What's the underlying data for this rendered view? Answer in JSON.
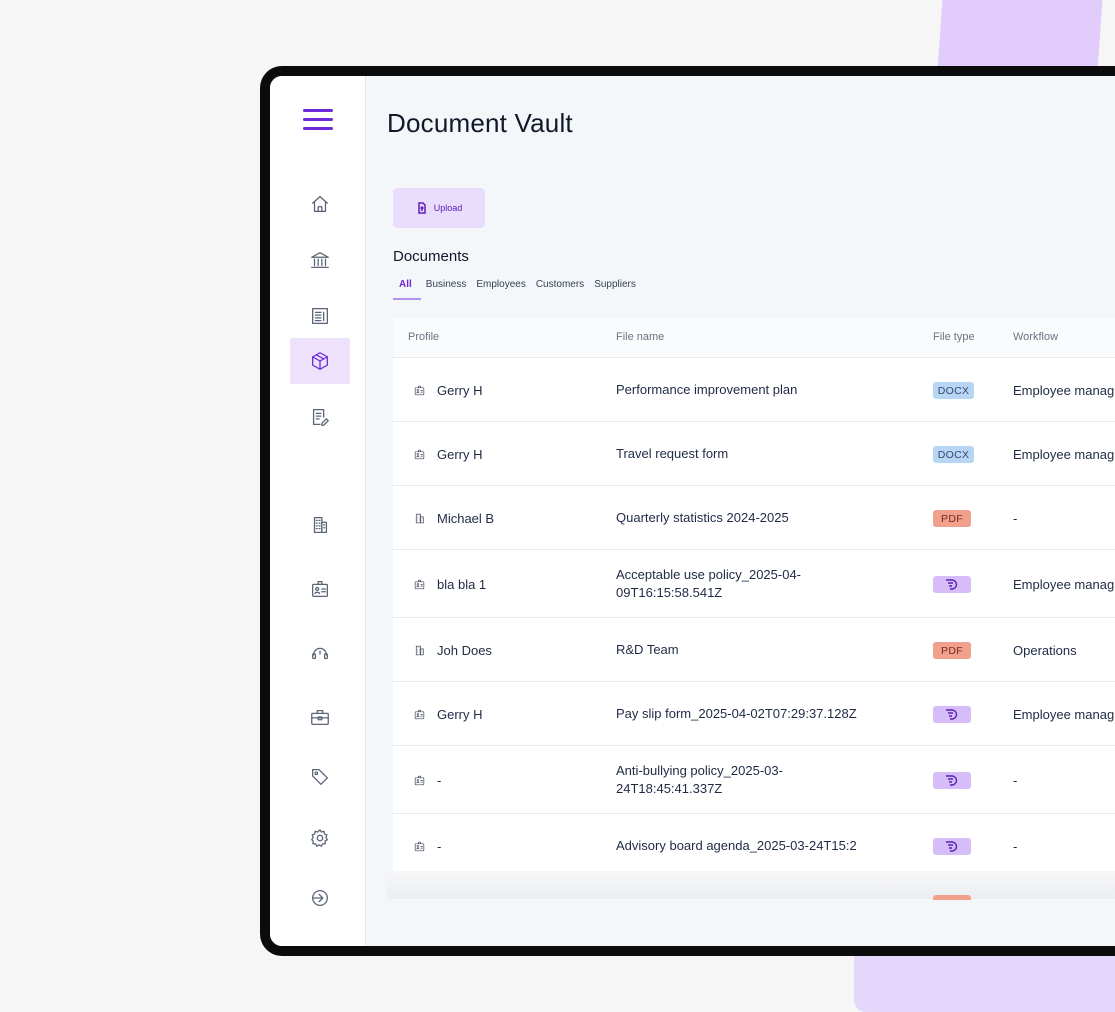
{
  "page": {
    "title": "Document Vault"
  },
  "colors": {
    "accent": "#6d28d9",
    "accent_light": "#ede1fb",
    "docx": "#b7d5f5",
    "pdf": "#f1a08c",
    "form": "#d6bdf7"
  },
  "sidebar": {
    "menu_icon": "hamburger-icon",
    "items": [
      {
        "icon": "home-icon",
        "active": false
      },
      {
        "icon": "bank-icon",
        "active": false
      },
      {
        "icon": "newspaper-icon",
        "active": false
      },
      {
        "icon": "box-icon",
        "active": true
      },
      {
        "icon": "document-edit-icon",
        "active": false
      },
      {
        "icon": "building-icon",
        "active": false
      },
      {
        "icon": "id-badge-icon",
        "active": false
      },
      {
        "icon": "headset-icon",
        "active": false
      },
      {
        "icon": "briefcase-icon",
        "active": false
      },
      {
        "icon": "tag-icon",
        "active": false
      },
      {
        "icon": "settings-icon",
        "active": false
      },
      {
        "icon": "logout-icon",
        "active": false
      }
    ]
  },
  "toolbar": {
    "upload_label": "Upload"
  },
  "documents": {
    "heading": "Documents",
    "tabs": [
      "All",
      "Business",
      "Employees",
      "Customers",
      "Suppliers"
    ],
    "active_tab": "All",
    "columns": [
      "Profile",
      "File name",
      "File type",
      "Workflow"
    ],
    "rows": [
      {
        "profile_icon": "id-badge-icon",
        "profile": "Gerry H",
        "file_name_lines": [
          "Performance improvement plan"
        ],
        "file_type": "DOCX",
        "workflow": "Employee manag"
      },
      {
        "profile_icon": "id-badge-icon",
        "profile": "Gerry H",
        "file_name_lines": [
          "Travel request form"
        ],
        "file_type": "DOCX",
        "workflow": "Employee manag"
      },
      {
        "profile_icon": "building-icon",
        "profile": "Michael B",
        "file_name_lines": [
          "Quarterly statistics 2024-2025"
        ],
        "file_type": "PDF",
        "workflow": "-"
      },
      {
        "profile_icon": "id-badge-icon",
        "profile": "bla bla 1",
        "file_name_lines": [
          "Acceptable use policy_2025-04-",
          "09T16:15:58.541Z"
        ],
        "file_type": "FORM",
        "workflow": "Employee manag"
      },
      {
        "profile_icon": "building-icon",
        "profile": "Joh Does",
        "file_name_lines": [
          "R&D Team"
        ],
        "file_type": "PDF",
        "workflow": "Operations"
      },
      {
        "profile_icon": "id-badge-icon",
        "profile": "Gerry H",
        "file_name_lines": [
          "Pay slip form_2025-04-02T07:29:37.128Z"
        ],
        "file_type": "FORM",
        "workflow": "Employee manag"
      },
      {
        "profile_icon": "id-badge-icon",
        "profile": "-",
        "file_name_lines": [
          "Anti-bullying policy_2025-03-",
          "24T18:45:41.337Z"
        ],
        "file_type": "FORM",
        "workflow": "-"
      },
      {
        "profile_icon": "id-badge-icon",
        "profile": "-",
        "file_name_lines": [
          "Advisory board agenda_2025-03-24T15:2"
        ],
        "file_type": "FORM",
        "workflow": "-"
      }
    ]
  }
}
